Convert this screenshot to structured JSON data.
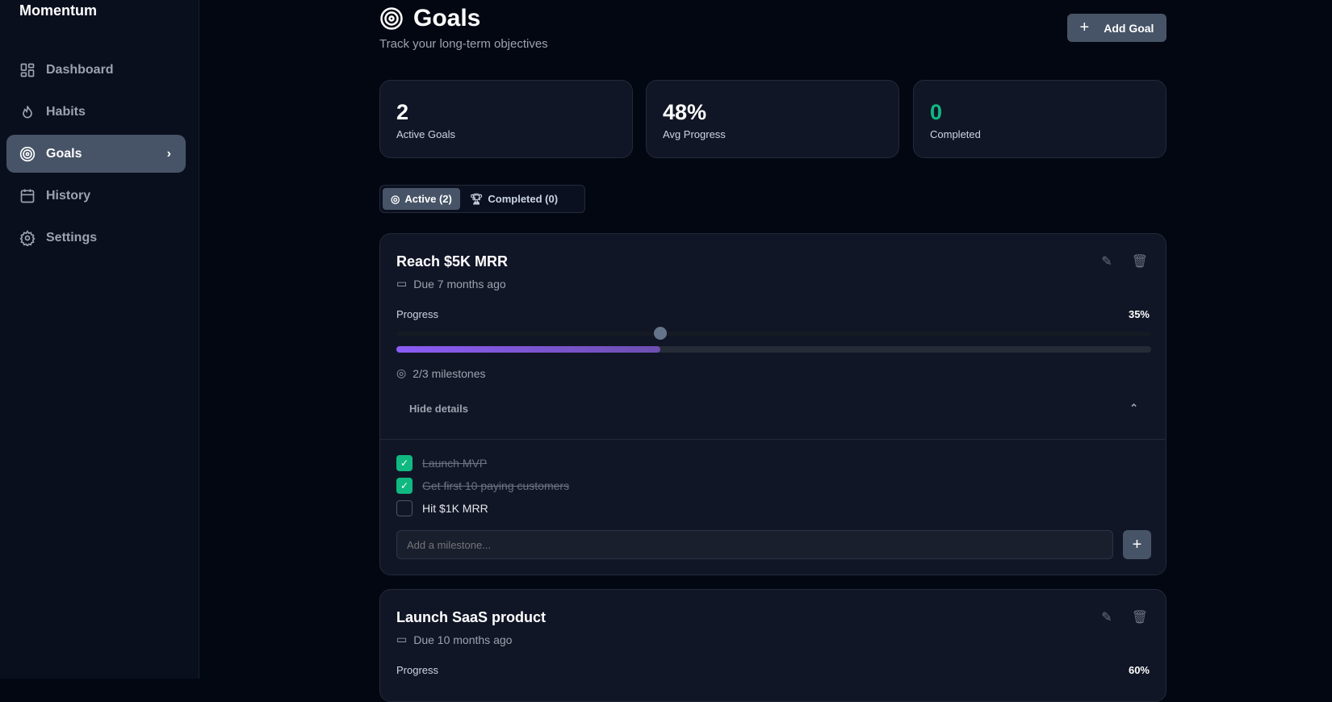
{
  "app": {
    "name": "Momentum"
  },
  "sidebar": {
    "items": [
      {
        "label": "Dashboard",
        "icon": "dashboard-icon"
      },
      {
        "label": "Habits",
        "icon": "flame-icon"
      },
      {
        "label": "Goals",
        "icon": "target-icon",
        "active": true
      },
      {
        "label": "History",
        "icon": "calendar-icon"
      },
      {
        "label": "Settings",
        "icon": "gear-icon"
      }
    ]
  },
  "header": {
    "title": "Goals",
    "subtitle": "Track your long-term objectives",
    "add_label": "Add Goal"
  },
  "stats": [
    {
      "value": "2",
      "label": "Active Goals"
    },
    {
      "value": "48%",
      "label": "Avg Progress"
    },
    {
      "value": "0",
      "label": "Completed"
    }
  ],
  "tabs": [
    {
      "label": "Active (2)"
    },
    {
      "label": "Completed (0)"
    }
  ],
  "goals": [
    {
      "title": "Reach $5K MRR",
      "due": "Due 7 months ago",
      "progress_label": "Progress",
      "progress": 35,
      "progress_text": "35%",
      "milestones_text": "2/3 milestones",
      "toggle_label": "Hide details",
      "milestones": [
        {
          "label": "Launch MVP",
          "done": true
        },
        {
          "label": "Get first 10 paying customers",
          "done": true
        },
        {
          "label": "Hit $1K MRR",
          "done": false
        }
      ],
      "milestone_placeholder": "Add a milestone..."
    },
    {
      "title": "Launch SaaS product",
      "due": "Due 10 months ago",
      "progress_label": "Progress",
      "progress": 60,
      "progress_text": "60%"
    }
  ],
  "colors": {
    "accent": "#475467",
    "success": "#10b981",
    "progress_start": "#8b5cf6",
    "progress_end": "#6d4fb0"
  }
}
